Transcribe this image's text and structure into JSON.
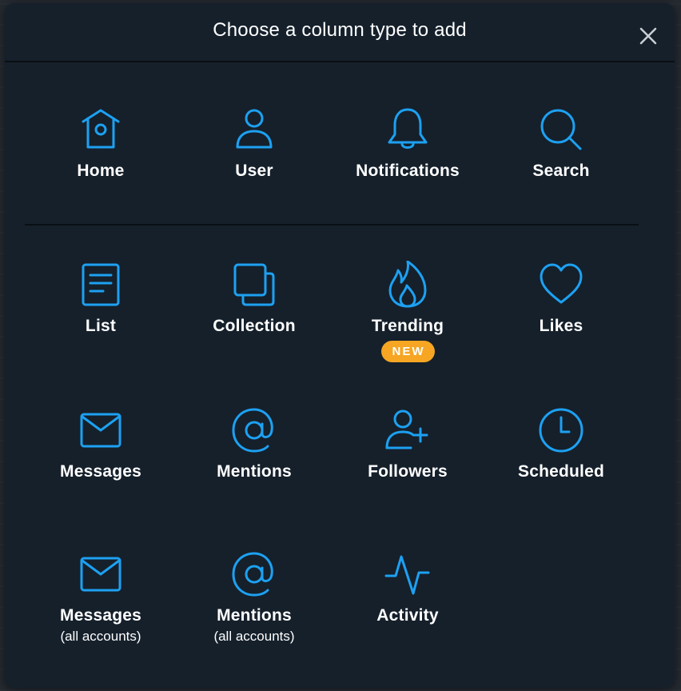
{
  "modal": {
    "title": "Choose a column type to add",
    "close_icon": "close-icon"
  },
  "colors": {
    "accent": "#1da1f2",
    "badge": "#f6a623",
    "panel": "#15202b",
    "text": "#ffffff"
  },
  "columns": [
    {
      "label": "Home",
      "icon": "home-icon"
    },
    {
      "label": "User",
      "icon": "user-icon"
    },
    {
      "label": "Notifications",
      "icon": "bell-icon"
    },
    {
      "label": "Search",
      "icon": "search-icon"
    },
    {
      "label": "List",
      "icon": "list-icon"
    },
    {
      "label": "Collection",
      "icon": "collection-icon"
    },
    {
      "label": "Trending",
      "icon": "flame-icon",
      "badge": "NEW"
    },
    {
      "label": "Likes",
      "icon": "heart-icon"
    },
    {
      "label": "Messages",
      "icon": "envelope-icon"
    },
    {
      "label": "Mentions",
      "icon": "at-sign-icon"
    },
    {
      "label": "Followers",
      "icon": "user-plus-icon"
    },
    {
      "label": "Scheduled",
      "icon": "clock-icon"
    },
    {
      "label": "Messages",
      "sublabel": "(all accounts)",
      "icon": "envelope-icon"
    },
    {
      "label": "Mentions",
      "sublabel": "(all accounts)",
      "icon": "at-sign-icon"
    },
    {
      "label": "Activity",
      "icon": "activity-icon"
    }
  ]
}
